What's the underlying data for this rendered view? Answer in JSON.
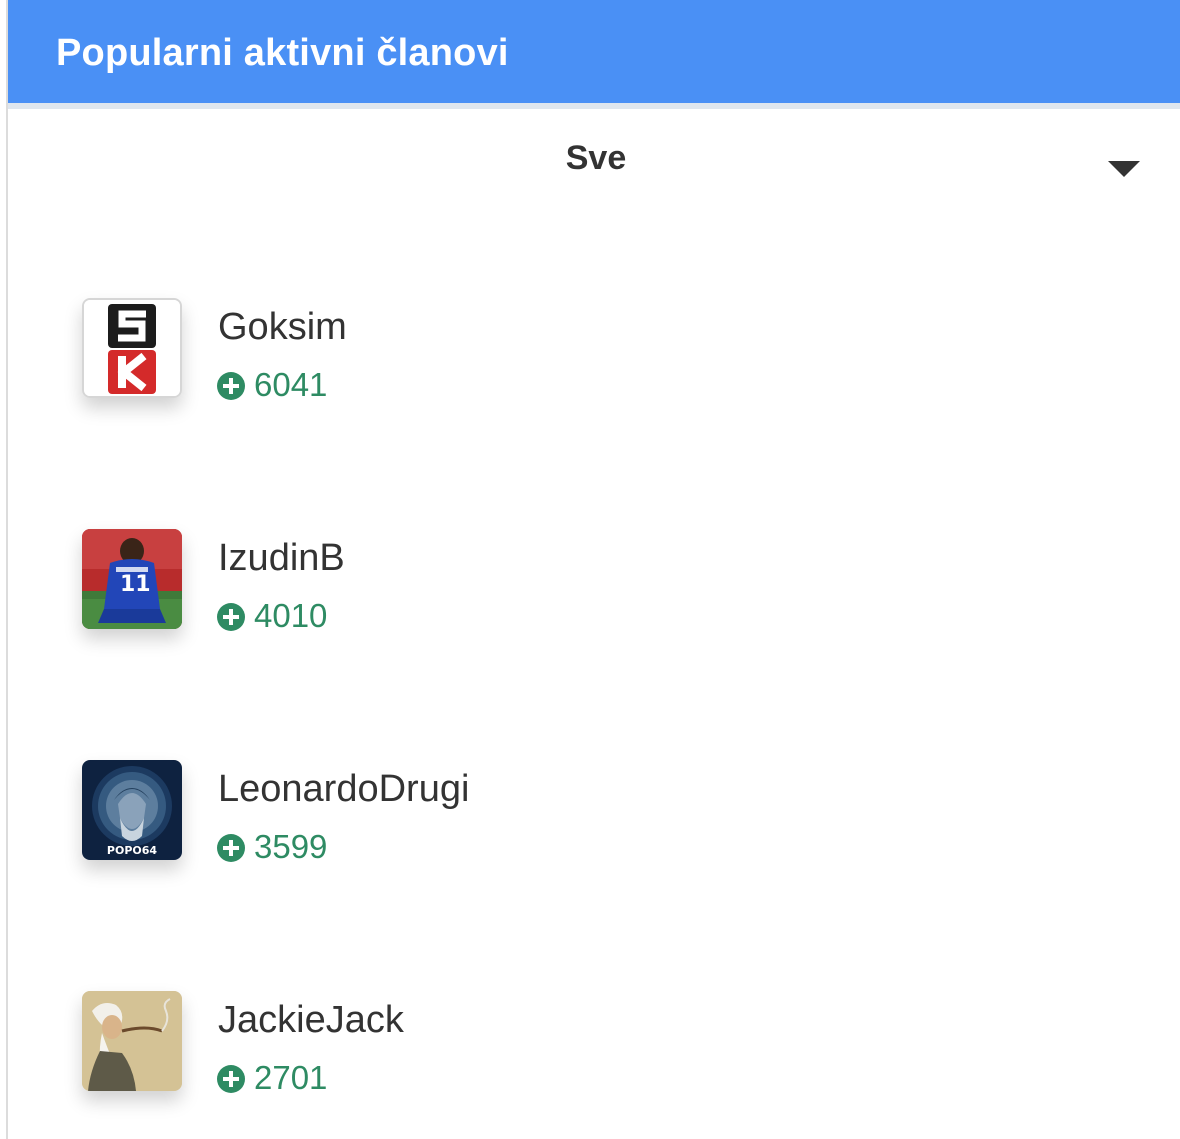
{
  "widget": {
    "title": "Popularni aktivni članovi",
    "filter": {
      "selected": "Sve",
      "icon": "caret-down-icon"
    }
  },
  "colors": {
    "header_bg": "#4a90f5",
    "points_green": "#2e8b63"
  },
  "members": [
    {
      "name": "Goksim",
      "points": "6041",
      "avatar": "sk-logo-avatar"
    },
    {
      "name": "IzudinB",
      "points": "4010",
      "avatar": "football-player-avatar"
    },
    {
      "name": "LeonardoDrugi",
      "points": "3599",
      "avatar": "leonardo-portrait-avatar",
      "avatar_caption": "POPO64"
    },
    {
      "name": "JackieJack",
      "points": "2701",
      "avatar": "old-sage-avatar"
    }
  ]
}
